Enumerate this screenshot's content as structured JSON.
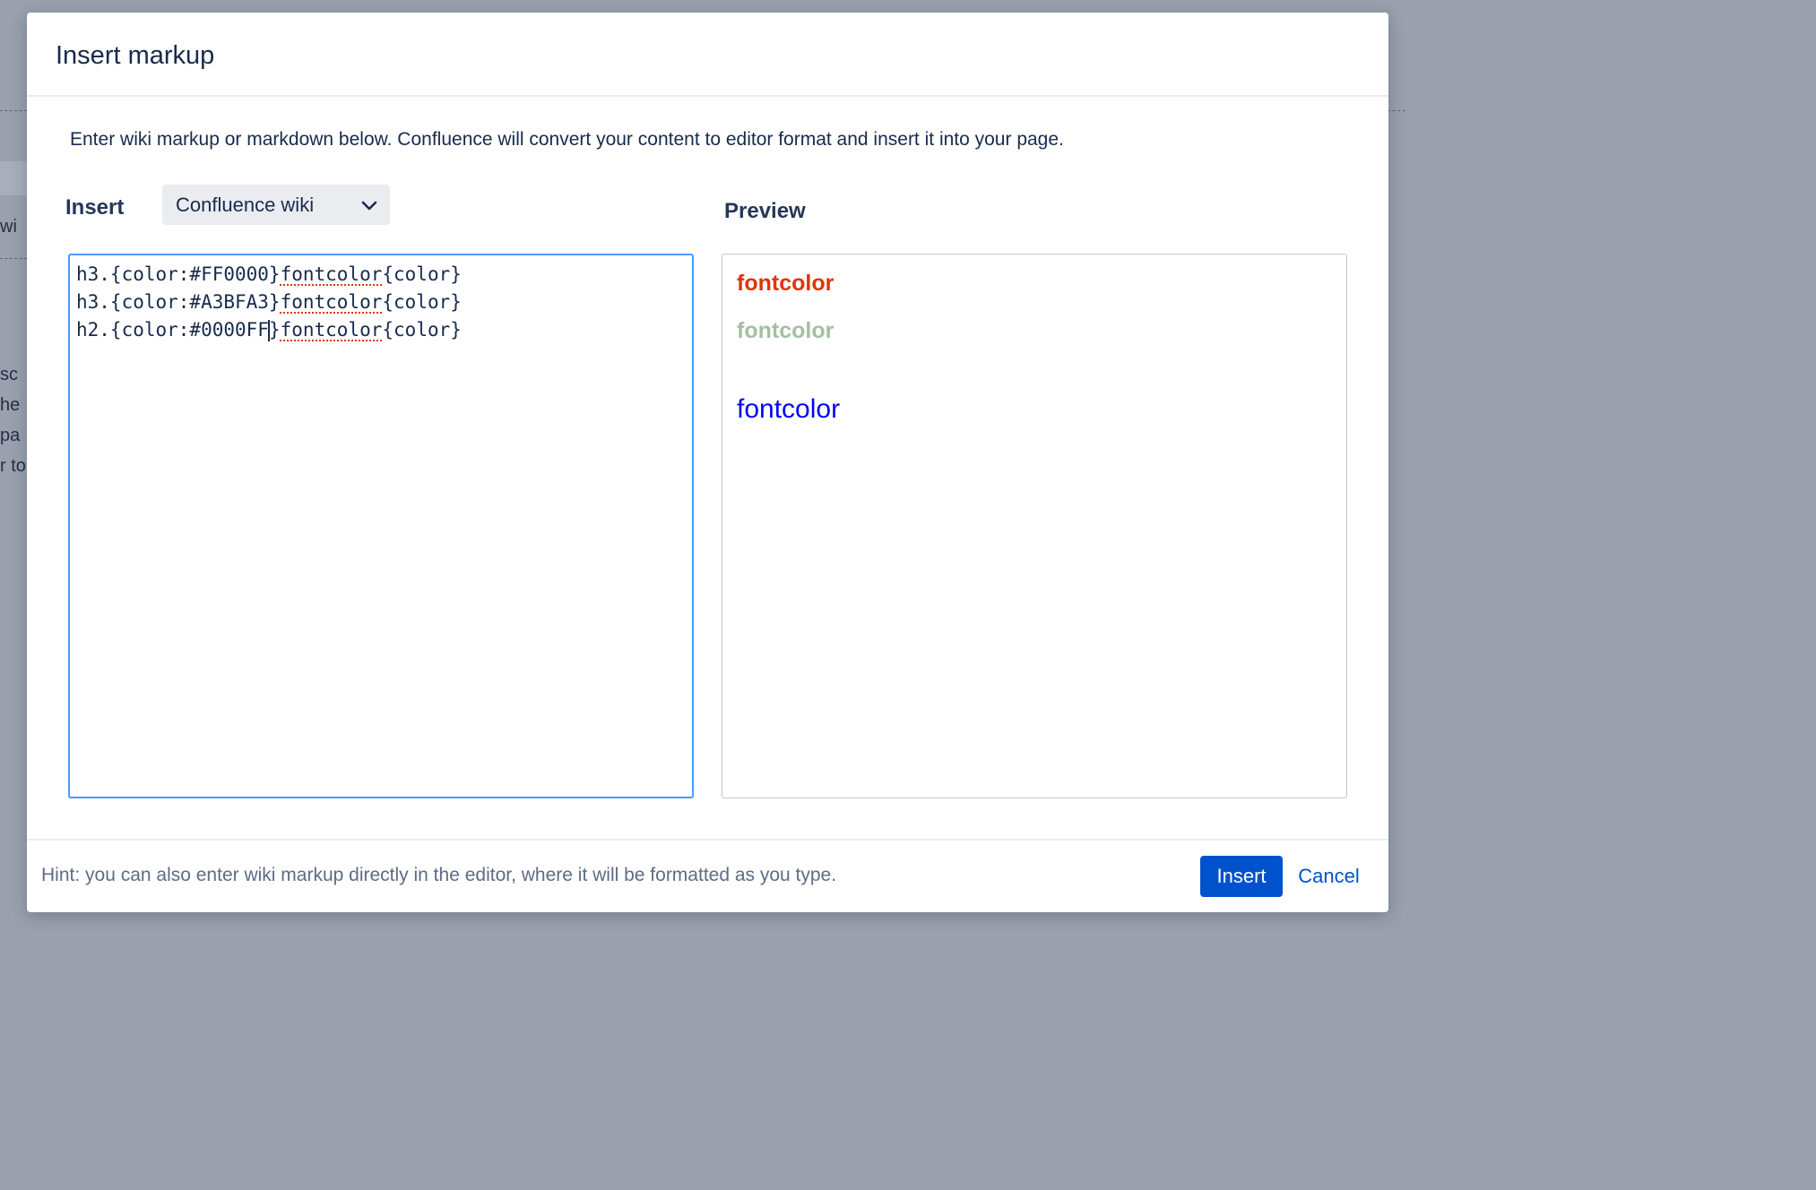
{
  "background": {
    "fragments": [
      "wi",
      "sc",
      "he",
      "pa",
      "r to"
    ]
  },
  "dialog": {
    "title": "Insert markup",
    "intro": "Enter wiki markup or markdown below. Confluence will convert your content to editor format and insert it into your page.",
    "insert_label": "Insert",
    "format_select": {
      "value": "Confluence wiki",
      "icon": "chevron-down-icon"
    },
    "preview_label": "Preview",
    "editor": {
      "lines": [
        {
          "pre": "h3.{color:#FF0000}",
          "word": "fontcolor",
          "post": "{color}"
        },
        {
          "pre": "h3.{color:#A3BFA3}",
          "word": "fontcolor",
          "post": "{color}"
        },
        {
          "pre_a": "h2.{color:#0000FF",
          "pre_b": "}",
          "word": "fontcolor",
          "post": "{color}"
        }
      ]
    },
    "preview": [
      {
        "level": "h3",
        "text": "fontcolor",
        "color": "#FF0000"
      },
      {
        "level": "h3",
        "text": "fontcolor",
        "color": "#A3BFA3"
      },
      {
        "level": "h2",
        "text": "fontcolor",
        "color": "#0000FF"
      }
    ],
    "footer": {
      "hint": "Hint: you can also enter wiki markup directly in the editor, where it will be formatted as you type.",
      "insert_button": "Insert",
      "cancel_button": "Cancel"
    }
  },
  "colors": {
    "primary": "#0052CC",
    "focus_border": "#4C9AFF",
    "overlay": "#9AA0AD"
  }
}
